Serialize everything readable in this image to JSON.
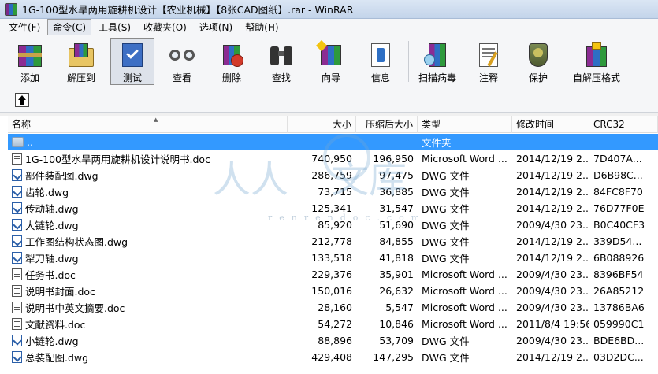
{
  "window": {
    "title": "1G-100型水旱两用旋耕机设计【农业机械】【8张CAD图纸】.rar - WinRAR"
  },
  "menu": [
    {
      "label": "文件(F)",
      "active": false
    },
    {
      "label": "命令(C)",
      "active": true
    },
    {
      "label": "工具(S)",
      "active": false
    },
    {
      "label": "收藏夹(O)",
      "active": false
    },
    {
      "label": "选项(N)",
      "active": false
    },
    {
      "label": "帮助(H)",
      "active": false
    }
  ],
  "toolbar": [
    {
      "label": "添加",
      "icon": "add-books-icon"
    },
    {
      "label": "解压到",
      "icon": "extract-folder-icon"
    },
    {
      "label": "测试",
      "icon": "test-check-icon",
      "pressed": true
    },
    {
      "label": "查看",
      "icon": "glasses-icon"
    },
    {
      "label": "删除",
      "icon": "delete-icon"
    },
    {
      "label": "查找",
      "icon": "binoculars-icon"
    },
    {
      "label": "向导",
      "icon": "wizard-icon"
    },
    {
      "label": "信息",
      "icon": "info-icon"
    },
    {
      "label": "扫描病毒",
      "icon": "virus-scan-icon"
    },
    {
      "label": "注释",
      "icon": "comment-icon"
    },
    {
      "label": "保护",
      "icon": "shield-icon"
    },
    {
      "label": "自解压格式",
      "icon": "sfx-icon"
    }
  ],
  "columns": {
    "name": "名称",
    "size": "大小",
    "packed": "压缩后大小",
    "type": "类型",
    "modified": "修改时间",
    "crc": "CRC32"
  },
  "files": [
    {
      "icon": "folder",
      "name": "..",
      "size": "",
      "packed": "",
      "type": "文件夹",
      "modified": "",
      "crc": "",
      "selected": true
    },
    {
      "icon": "doc",
      "name": "1G-100型水旱两用旋耕机设计说明书.doc",
      "size": "740,950",
      "packed": "196,950",
      "type": "Microsoft Word ...",
      "modified": "2014/12/19 2...",
      "crc": "7D407A..."
    },
    {
      "icon": "dwg",
      "name": "部件装配图.dwg",
      "size": "286,759",
      "packed": "97,475",
      "type": "DWG 文件",
      "modified": "2014/12/19 2...",
      "crc": "D6B98C..."
    },
    {
      "icon": "dwg",
      "name": "齿轮.dwg",
      "size": "73,715",
      "packed": "36,885",
      "type": "DWG 文件",
      "modified": "2014/12/19 2...",
      "crc": "84FC8F70"
    },
    {
      "icon": "dwg",
      "name": "传动轴.dwg",
      "size": "125,341",
      "packed": "31,547",
      "type": "DWG 文件",
      "modified": "2014/12/19 2...",
      "crc": "76D77F0E"
    },
    {
      "icon": "dwg",
      "name": "大链轮.dwg",
      "size": "85,920",
      "packed": "51,690",
      "type": "DWG 文件",
      "modified": "2009/4/30 23...",
      "crc": "B0C40CF3"
    },
    {
      "icon": "dwg",
      "name": "工作图结构状态图.dwg",
      "size": "212,778",
      "packed": "84,855",
      "type": "DWG 文件",
      "modified": "2014/12/19 2...",
      "crc": "339D54..."
    },
    {
      "icon": "dwg",
      "name": "犁刀轴.dwg",
      "size": "133,518",
      "packed": "41,818",
      "type": "DWG 文件",
      "modified": "2014/12/19 2...",
      "crc": "6B088926"
    },
    {
      "icon": "doc",
      "name": "任务书.doc",
      "size": "229,376",
      "packed": "35,901",
      "type": "Microsoft Word ...",
      "modified": "2009/4/30 23...",
      "crc": "8396BF54"
    },
    {
      "icon": "doc",
      "name": "说明书封面.doc",
      "size": "150,016",
      "packed": "26,632",
      "type": "Microsoft Word ...",
      "modified": "2009/4/30 23...",
      "crc": "26A85212"
    },
    {
      "icon": "doc",
      "name": "说明书中英文摘要.doc",
      "size": "28,160",
      "packed": "5,547",
      "type": "Microsoft Word ...",
      "modified": "2009/4/30 23...",
      "crc": "13786BA6"
    },
    {
      "icon": "doc",
      "name": "文献资料.doc",
      "size": "54,272",
      "packed": "10,846",
      "type": "Microsoft Word ...",
      "modified": "2011/8/4 19:56",
      "crc": "059990C1"
    },
    {
      "icon": "dwg",
      "name": "小链轮.dwg",
      "size": "88,896",
      "packed": "53,709",
      "type": "DWG 文件",
      "modified": "2009/4/30 23...",
      "crc": "BDE6BD..."
    },
    {
      "icon": "dwg",
      "name": "总装配图.dwg",
      "size": "429,408",
      "packed": "147,295",
      "type": "DWG 文件",
      "modified": "2014/12/19 2...",
      "crc": "03D2DC..."
    }
  ],
  "watermark": {
    "text1": "人人",
    "text2": "文库",
    "url": "renrendoc.com"
  }
}
